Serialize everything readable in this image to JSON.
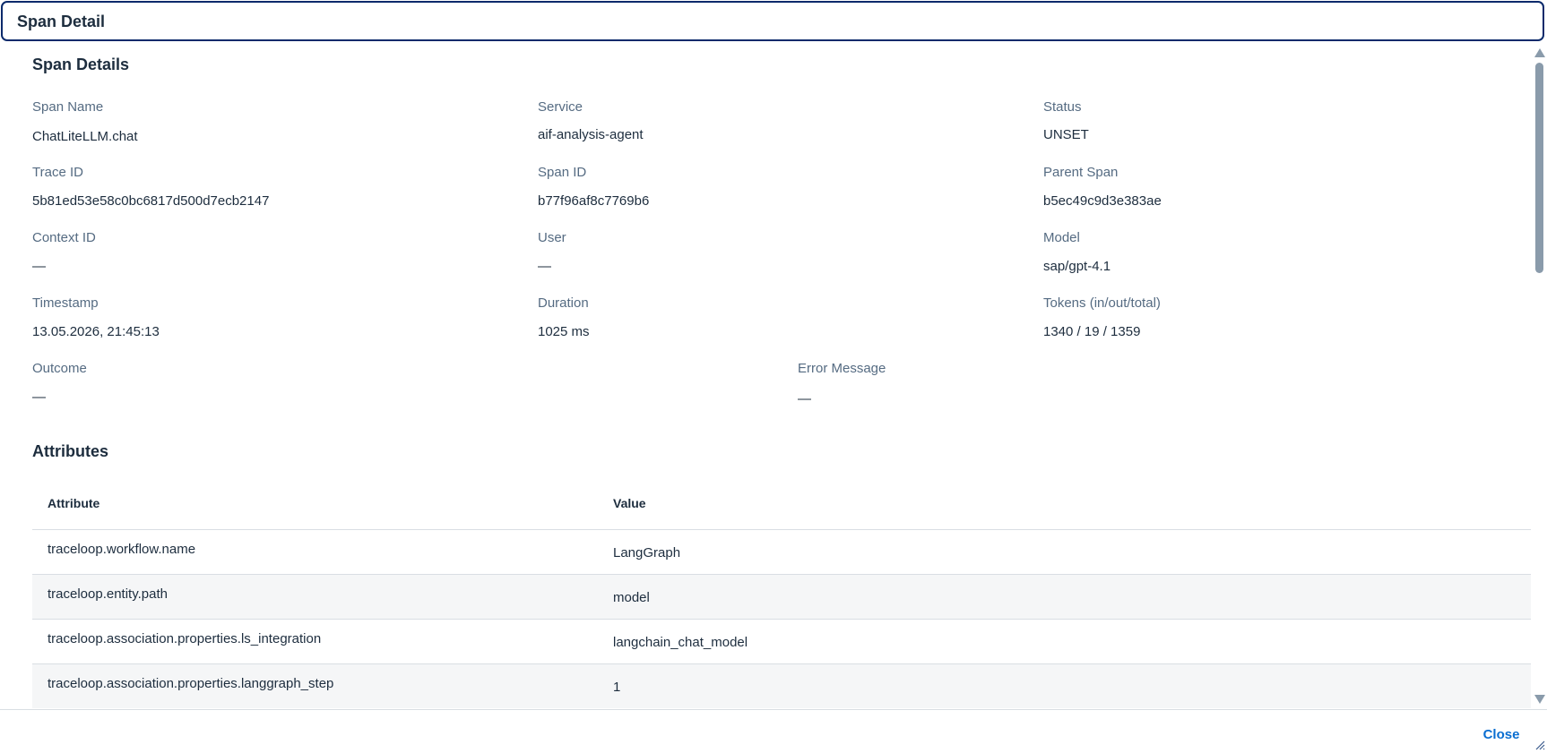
{
  "dialog": {
    "title": "Span Detail",
    "close_label": "Close"
  },
  "span_details": {
    "section_title": "Span Details",
    "fields": {
      "span_name": {
        "label": "Span Name",
        "value": "ChatLiteLLM.chat"
      },
      "service": {
        "label": "Service",
        "value": "aif-analysis-agent"
      },
      "status": {
        "label": "Status",
        "value": "UNSET"
      },
      "trace_id": {
        "label": "Trace ID",
        "value": "5b81ed53e58c0bc6817d500d7ecb2147"
      },
      "span_id": {
        "label": "Span ID",
        "value": "b77f96af8c7769b6"
      },
      "parent_span": {
        "label": "Parent Span",
        "value": "b5ec49c9d3e383ae"
      },
      "context_id": {
        "label": "Context ID",
        "value": "—"
      },
      "user": {
        "label": "User",
        "value": "—"
      },
      "model": {
        "label": "Model",
        "value": "sap/gpt-4.1"
      },
      "timestamp": {
        "label": "Timestamp",
        "value": "13.05.2026, 21:45:13"
      },
      "duration": {
        "label": "Duration",
        "value": "1025 ms"
      },
      "tokens": {
        "label": "Tokens (in/out/total)",
        "value": "1340 / 19 / 1359"
      },
      "outcome": {
        "label": "Outcome",
        "value": "—"
      },
      "error_message": {
        "label": "Error Message",
        "value": "—"
      }
    }
  },
  "attributes": {
    "section_title": "Attributes",
    "columns": [
      "Attribute",
      "Value"
    ],
    "rows": [
      {
        "attribute": "traceloop.workflow.name",
        "value": "LangGraph"
      },
      {
        "attribute": "traceloop.entity.path",
        "value": "model"
      },
      {
        "attribute": "traceloop.association.properties.ls_integration",
        "value": "langchain_chat_model"
      },
      {
        "attribute": "traceloop.association.properties.langgraph_step",
        "value": "1"
      }
    ]
  },
  "icons": {
    "scroll_up": "scroll-up-arrow-icon",
    "scroll_down": "scroll-down-arrow-icon",
    "resize": "resize-grip-icon"
  },
  "colors": {
    "header_border": "#0a2a6b",
    "label": "#556b82",
    "text": "#1d2d3e",
    "link": "#0a6ed1",
    "row_alt": "#f5f6f7"
  }
}
